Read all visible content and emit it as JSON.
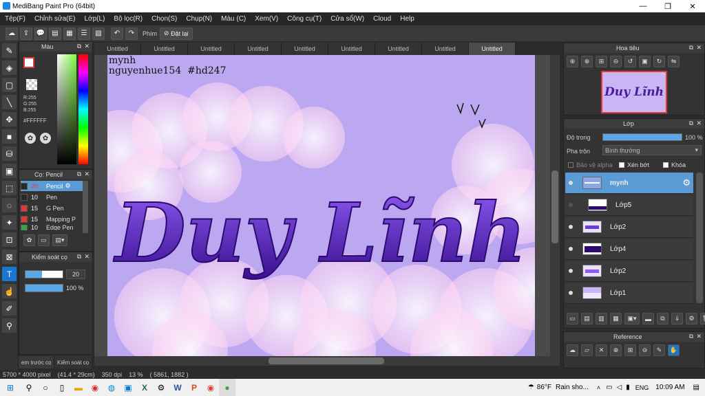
{
  "app": {
    "title": "MediBang Paint Pro (64bit)"
  },
  "window_controls": {
    "minimize": "—",
    "maximize": "❐",
    "close": "✕"
  },
  "menu": [
    "Tệp(F)",
    "Chỉnh sửa(E)",
    "Lớp(L)",
    "Bộ lọc(R)",
    "Chọn(S)",
    "Chụp(N)",
    "Màu (C)",
    "Xem(V)",
    "Công cụ(T)",
    "Cửa sổ(W)",
    "Cloud",
    "Help"
  ],
  "toolbar": {
    "shortcut_label": "Phím",
    "reset_label": "Đặt lại"
  },
  "color_panel": {
    "title": "Màu",
    "r": "R:255",
    "g": "G:255",
    "b": "B:255",
    "hex": "#FFFFFF"
  },
  "brush_panel": {
    "title": "Cọ: Pencil",
    "items": [
      {
        "size": "20",
        "name": "Pencil",
        "color": "#2a2a2a"
      },
      {
        "size": "10",
        "name": "Pen",
        "color": "#2a2a2a"
      },
      {
        "size": "15",
        "name": "G Pen",
        "color": "#e53935"
      },
      {
        "size": "15",
        "name": "Mapping P",
        "color": "#e53935"
      },
      {
        "size": "10",
        "name": "Edge Pen",
        "color": "#43a047"
      }
    ]
  },
  "brush_control": {
    "title": "Kiểm soát cọ",
    "size": "20",
    "opacity": "100 %",
    "size_level": 0.45,
    "opacity_level": 1.0
  },
  "bottom_tabs": {
    "tab1": "em trước cọ",
    "tab2": "Kiểm soát cọ"
  },
  "tabs": [
    "Untitled",
    "Untitled",
    "Untitled",
    "Untitled",
    "Untitled",
    "Untitled",
    "Untitled",
    "Untitled",
    "Untitled"
  ],
  "canvas": {
    "line1": "mynh",
    "line2": "nguyenhue154  #hd247",
    "art_text": "Duy Lĩnh"
  },
  "navigator": {
    "title": "Hoa tiêu",
    "thumb_text": "Duy Lĩnh"
  },
  "layer_panel": {
    "title": "Lớp",
    "opacity_label": "Độ trong",
    "opacity_value": "100 %",
    "opacity_level": 1.0,
    "blend_label": "Pha trộn",
    "blend_value": "Bình thường",
    "protect_alpha": "Bảo vệ alpha",
    "clip": "Xén bớt",
    "lock": "Khóa",
    "layers": [
      {
        "name": "mynh"
      },
      {
        "name": "Lớp5"
      },
      {
        "name": "Lớp2"
      },
      {
        "name": "Lớp4"
      },
      {
        "name": "Lớp2"
      },
      {
        "name": "Lớp1"
      }
    ]
  },
  "reference_panel": {
    "title": "Reference"
  },
  "status": {
    "dims": "5700 * 4000 pixel",
    "cm": "(41.4 * 29cm)",
    "dpi": "350 dpi",
    "zoom": "13 %",
    "coords": "( 5861, 1882 )"
  },
  "taskbar": {
    "weather_temp": "86°F",
    "weather_text": "Rain sho...",
    "lang": "ENG",
    "time": "10:09 AM"
  },
  "colors": {
    "accent": "#5b9bd5",
    "canvas_bg": "#b9a6ee",
    "text_purple": "#4a1aa0"
  }
}
